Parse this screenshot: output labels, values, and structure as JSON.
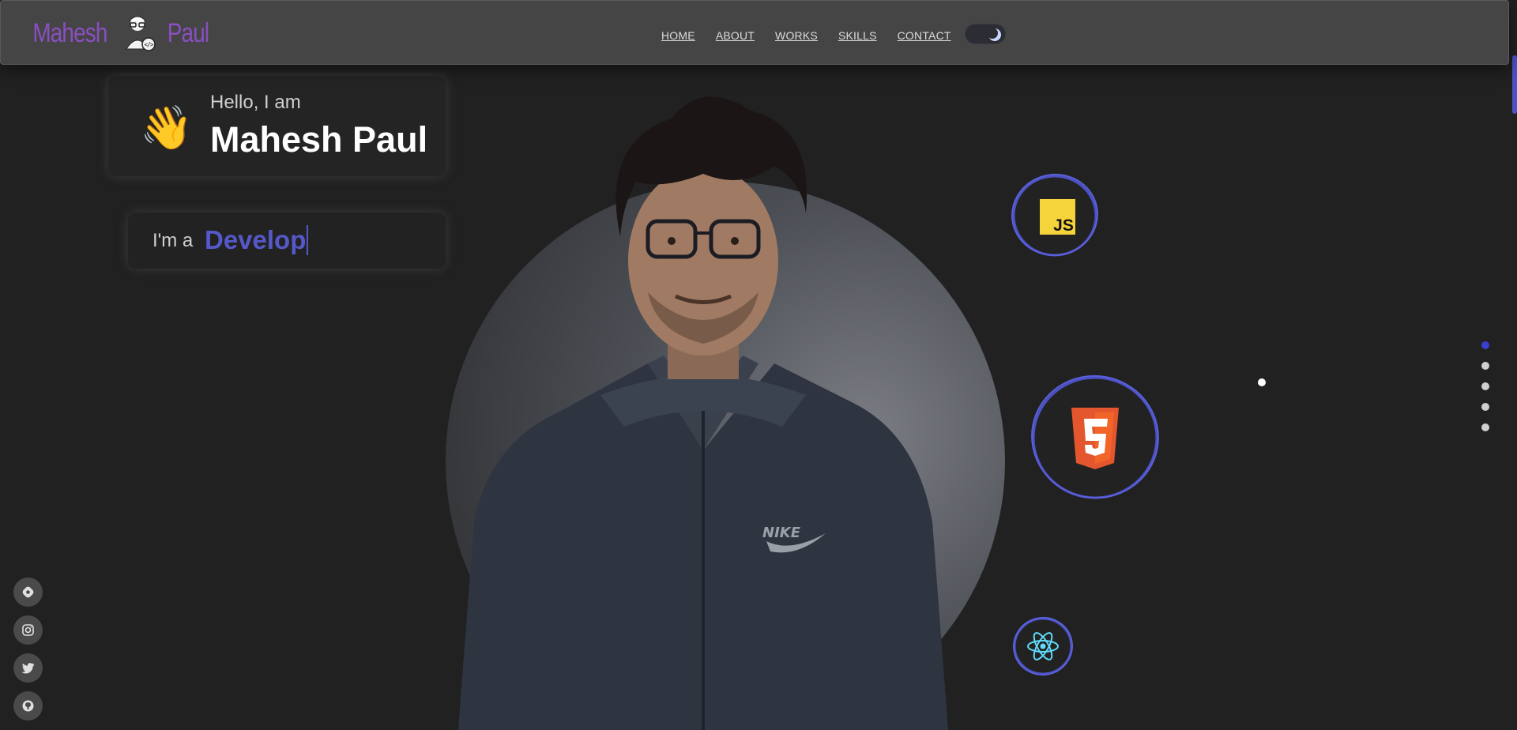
{
  "logo": {
    "first": "Mahesh",
    "last": "Paul",
    "icon": "developer-avatar-icon"
  },
  "nav": {
    "links": [
      "HOME",
      "ABOUT",
      "WORKS",
      "SKILLS",
      "CONTACT"
    ],
    "theme_toggle_icon": "moon-icon"
  },
  "hero": {
    "greeting": "Hello, I am",
    "name": "Mahesh Paul",
    "wave_emoji": "👋",
    "role_prefix": "I'm a",
    "role_typed": "Develop"
  },
  "tech_icons": [
    "javascript-icon",
    "html5-icon",
    "react-icon"
  ],
  "js_badge": "JS",
  "pager": {
    "count": 5,
    "active_index": 0
  },
  "socials": [
    "hashnode-icon",
    "instagram-icon",
    "twitter-icon",
    "github-icon"
  ],
  "colors": {
    "background": "#212121",
    "navbar": "#454545",
    "logo": "#8a4fc0",
    "accent": "#5658c9",
    "ring": "#4c52c5"
  }
}
